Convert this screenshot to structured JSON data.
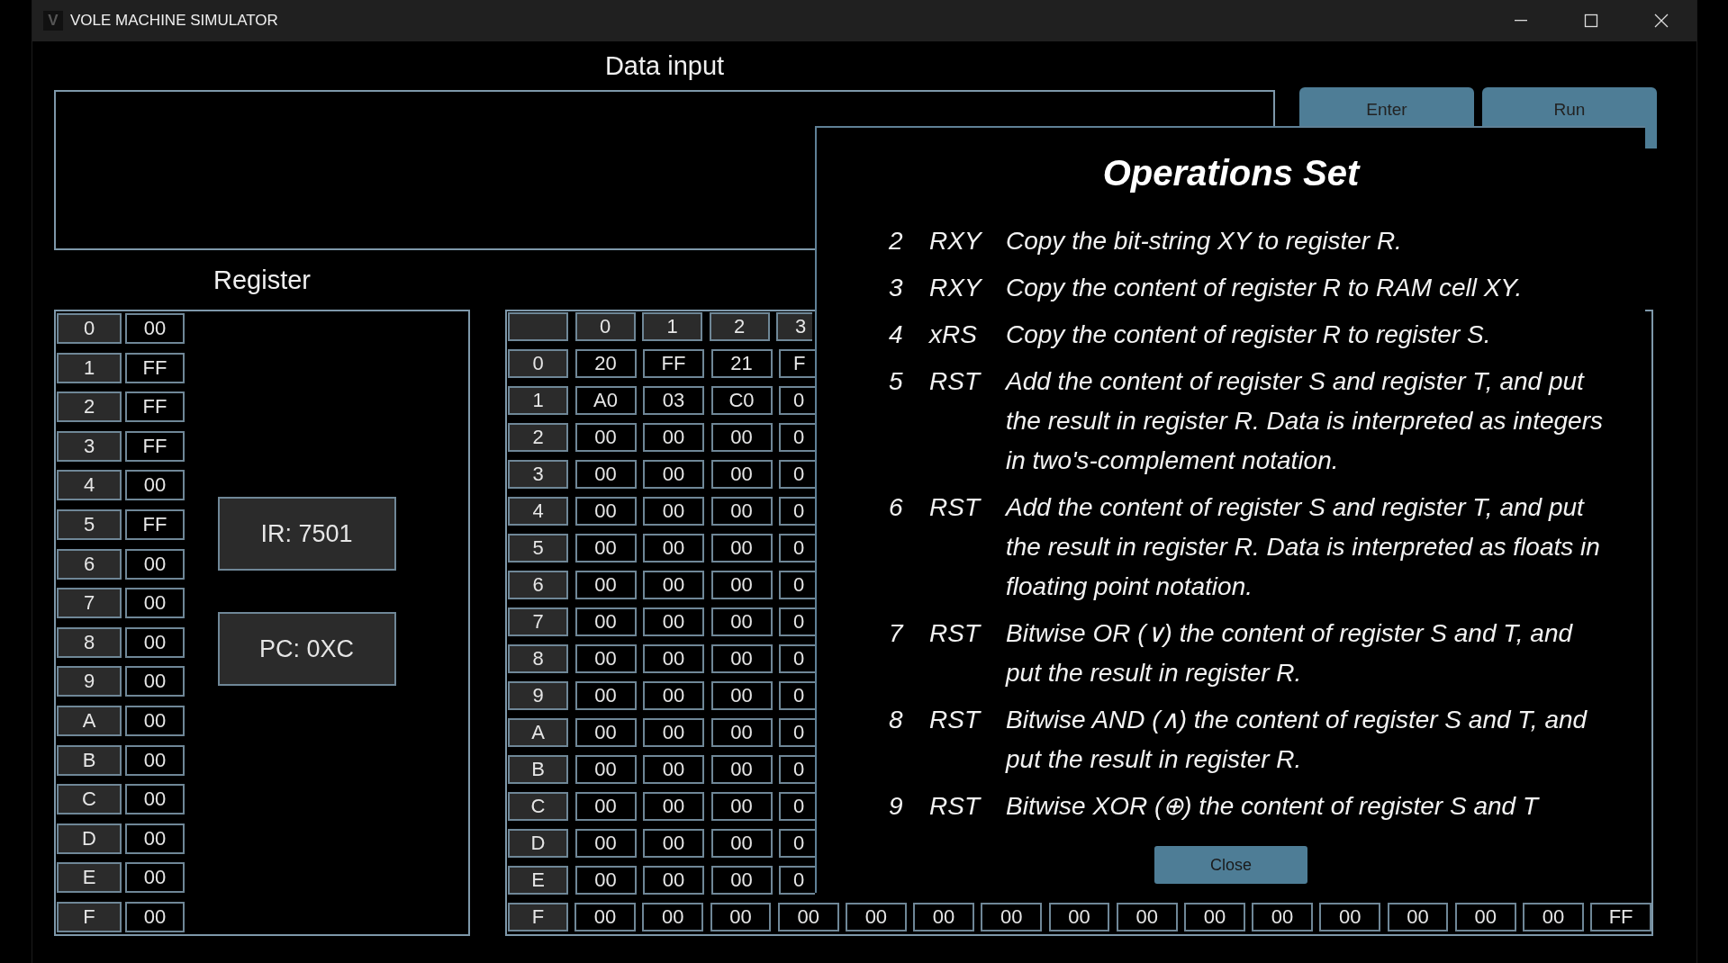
{
  "window": {
    "title": "VOLE MACHINE SIMULATOR",
    "icon_letter": "V"
  },
  "data_input": {
    "label": "Data input"
  },
  "buttons": [
    {
      "label": "Enter"
    },
    {
      "label": "Run"
    }
  ],
  "register": {
    "label": "Register",
    "ir": "IR: 7501",
    "pc": "PC: 0XC",
    "rows": [
      {
        "index": "0",
        "value": "00"
      },
      {
        "index": "1",
        "value": "FF"
      },
      {
        "index": "2",
        "value": "FF"
      },
      {
        "index": "3",
        "value": "FF"
      },
      {
        "index": "4",
        "value": "00"
      },
      {
        "index": "5",
        "value": "FF"
      },
      {
        "index": "6",
        "value": "00"
      },
      {
        "index": "7",
        "value": "00"
      },
      {
        "index": "8",
        "value": "00"
      },
      {
        "index": "9",
        "value": "00"
      },
      {
        "index": "A",
        "value": "00"
      },
      {
        "index": "B",
        "value": "00"
      },
      {
        "index": "C",
        "value": "00"
      },
      {
        "index": "D",
        "value": "00"
      },
      {
        "index": "E",
        "value": "00"
      },
      {
        "index": "F",
        "value": "00"
      }
    ]
  },
  "memory": {
    "columns": [
      "0",
      "1",
      "2",
      "3"
    ],
    "rows": [
      {
        "index": "0",
        "cells": [
          "20",
          "FF",
          "21",
          "F"
        ]
      },
      {
        "index": "1",
        "cells": [
          "A0",
          "03",
          "C0",
          "0"
        ]
      },
      {
        "index": "2",
        "cells": [
          "00",
          "00",
          "00",
          "0"
        ]
      },
      {
        "index": "3",
        "cells": [
          "00",
          "00",
          "00",
          "0"
        ]
      },
      {
        "index": "4",
        "cells": [
          "00",
          "00",
          "00",
          "0"
        ]
      },
      {
        "index": "5",
        "cells": [
          "00",
          "00",
          "00",
          "0"
        ]
      },
      {
        "index": "6",
        "cells": [
          "00",
          "00",
          "00",
          "0"
        ]
      },
      {
        "index": "7",
        "cells": [
          "00",
          "00",
          "00",
          "0"
        ]
      },
      {
        "index": "8",
        "cells": [
          "00",
          "00",
          "00",
          "0"
        ]
      },
      {
        "index": "9",
        "cells": [
          "00",
          "00",
          "00",
          "0"
        ]
      },
      {
        "index": "A",
        "cells": [
          "00",
          "00",
          "00",
          "0"
        ]
      },
      {
        "index": "B",
        "cells": [
          "00",
          "00",
          "00",
          "0"
        ]
      },
      {
        "index": "C",
        "cells": [
          "00",
          "00",
          "00",
          "0"
        ]
      },
      {
        "index": "D",
        "cells": [
          "00",
          "00",
          "00",
          "0"
        ]
      },
      {
        "index": "E",
        "cells": [
          "00",
          "00",
          "00",
          "0"
        ]
      },
      {
        "index": "F",
        "cells": [
          "00",
          "00",
          "00",
          "00",
          "00",
          "00",
          "00",
          "00",
          "00",
          "00",
          "00",
          "00",
          "00",
          "00",
          "00",
          "FF"
        ]
      }
    ]
  },
  "dialog": {
    "title": "Operations Set",
    "close": "Close",
    "operations": [
      {
        "code": "2",
        "operands": "RXY",
        "description": "Copy the bit-string XY to register R."
      },
      {
        "code": "3",
        "operands": "RXY",
        "description": "Copy the content of register R to RAM cell XY."
      },
      {
        "code": "4",
        "operands": "xRS",
        "description": "Copy the content of register R to register S."
      },
      {
        "code": "5",
        "operands": "RST",
        "description": "Add the content of register S and register T, and put the result in register R. Data is interpreted as integers in two's-complement notation."
      },
      {
        "code": "6",
        "operands": "RST",
        "description": "Add the content of register S and register T, and put the result in register R. Data is interpreted as floats in floating point notation."
      },
      {
        "code": "7",
        "operands": "RST",
        "description": "Bitwise OR (∨) the content of register S and T, and put the result in register R."
      },
      {
        "code": "8",
        "operands": "RST",
        "description": "Bitwise AND (∧) the content of register S and T, and put the result in register R."
      },
      {
        "code": "9",
        "operands": "RST",
        "description": "Bitwise XOR (⊕) the content of register S and T"
      }
    ]
  }
}
